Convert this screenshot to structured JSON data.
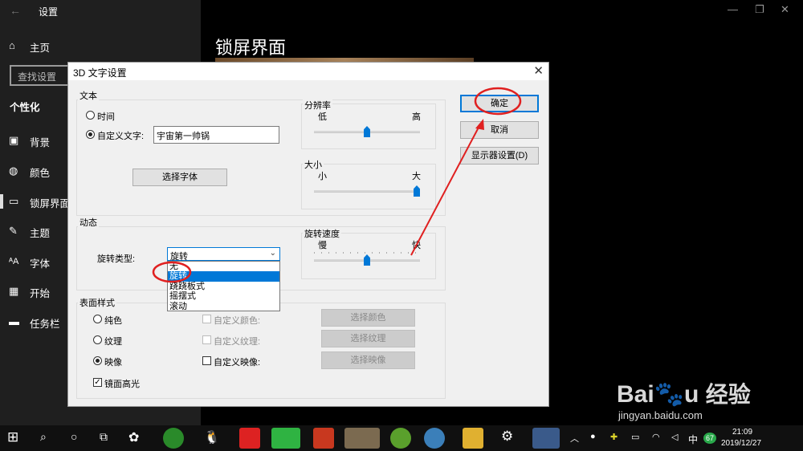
{
  "settings": {
    "title": "设置",
    "home": "主页",
    "search_placeholder": "查找设置",
    "section": "个性化",
    "nav": [
      {
        "label": "背景",
        "icon": "image-icon"
      },
      {
        "label": "颜色",
        "icon": "palette-icon"
      },
      {
        "label": "锁屏界面",
        "icon": "lock-screen-icon"
      },
      {
        "label": "主题",
        "icon": "theme-icon"
      },
      {
        "label": "字体",
        "icon": "font-icon"
      },
      {
        "label": "开始",
        "icon": "start-icon"
      },
      {
        "label": "任务栏",
        "icon": "taskbar-icon"
      }
    ],
    "page_title": "锁屏界面"
  },
  "dialog": {
    "title": "3D 文字设置",
    "text_group": {
      "label": "文本",
      "radio_time": "时间",
      "radio_custom": "自定义文字:",
      "custom_value": "宇宙第一帅锅",
      "font_button": "选择字体"
    },
    "resolution": {
      "label": "分辨率",
      "low": "低",
      "high": "高",
      "value": 0.5
    },
    "size": {
      "label": "大小",
      "small": "小",
      "large": "大",
      "value": 1.0
    },
    "motion": {
      "label": "动态",
      "rotation_type_label": "旋转类型:",
      "selected": "旋转",
      "options": [
        "无",
        "旋转",
        "跷跷板式",
        "摇摆式",
        "滚动"
      ],
      "speed_label": "旋转速度",
      "slow": "慢",
      "fast": "快",
      "speed_value": 0.5
    },
    "surface": {
      "label": "表面样式",
      "solid": "纯色",
      "texture": "纹理",
      "reflection": "映像",
      "custom_color": "自定义颜色:",
      "custom_texture": "自定义纹理:",
      "custom_reflection": "自定义映像:",
      "choose_color": "选择颜色",
      "choose_texture": "选择纹理",
      "choose_reflection": "选择映像",
      "specular": "镜面高光"
    },
    "ok": "确定",
    "cancel": "取消",
    "display_settings": "显示器设置(D)"
  },
  "taskbar": {
    "ime": "中",
    "badge": "67",
    "time": "21:09",
    "date": "2019/12/27"
  },
  "watermark": {
    "logo": "Bai",
    "logo_end": "u",
    "brand": "经验",
    "url": "jingyan.baidu.com"
  },
  "colors": {
    "accent": "#0078d7",
    "annotation": "#e02020"
  }
}
